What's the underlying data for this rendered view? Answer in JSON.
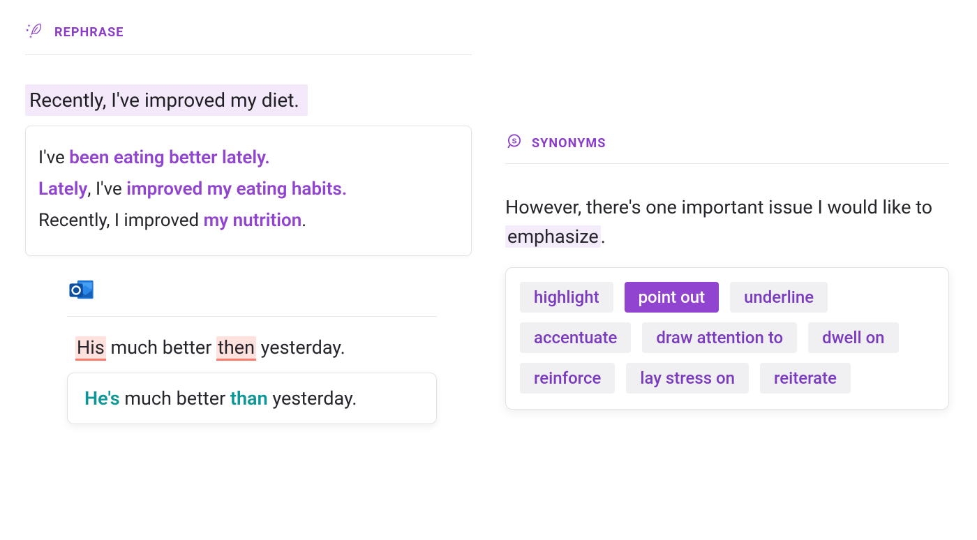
{
  "rephrase": {
    "title": "REPHRASE",
    "input": "Recently, I've improved my diet.",
    "options": [
      {
        "plain_before": "I've ",
        "highlight": "been eating better lately.",
        "plain_after": ""
      },
      {
        "plain_before": "",
        "highlight": "Lately",
        "plain_mid": ", I've ",
        "highlight2": "improved my eating habits.",
        "plain_after": ""
      },
      {
        "plain_before": "Recently, I improved ",
        "highlight": "my nutrition",
        "plain_after": "."
      }
    ]
  },
  "grammar": {
    "input": {
      "w1": "His",
      "p1": " much better ",
      "w2": "then",
      "p2": " yesterday."
    },
    "fix": {
      "w1": "He's",
      "p1": " much better ",
      "w2": "than",
      "p2": " yesterday."
    }
  },
  "synonyms": {
    "title": "SYNONYMS",
    "sentence_before": "However, there's one important issue I would like to ",
    "target": "emphasize",
    "sentence_after": ".",
    "options": [
      {
        "label": "highlight",
        "active": false
      },
      {
        "label": "point out",
        "active": true
      },
      {
        "label": "underline",
        "active": false
      },
      {
        "label": "accentuate",
        "active": false
      },
      {
        "label": "draw attention to",
        "active": false
      },
      {
        "label": "dwell on",
        "active": false
      },
      {
        "label": "reinforce",
        "active": false
      },
      {
        "label": "lay stress on",
        "active": false
      },
      {
        "label": "reiterate",
        "active": false
      }
    ]
  }
}
